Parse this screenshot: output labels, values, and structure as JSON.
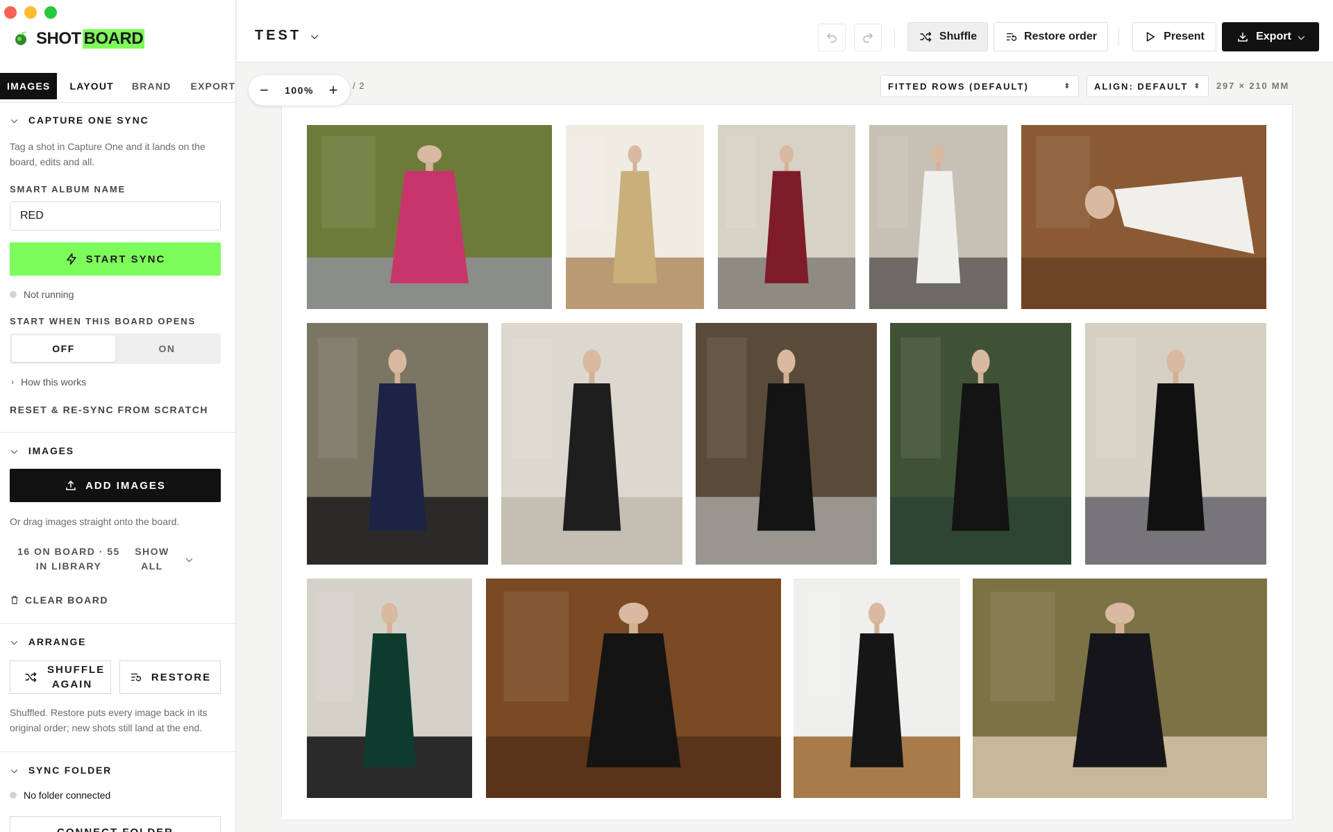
{
  "app": {
    "logo": {
      "part1": "SHOT",
      "part2": "BOARD"
    }
  },
  "sidebar": {
    "tabs": [
      "IMAGES",
      "LAYOUT",
      "BRAND",
      "EXPORT"
    ],
    "capture_one": {
      "title": "CAPTURE ONE SYNC",
      "description": "Tag a shot in Capture One and it lands on the board, edits and all.",
      "album_label": "SMART ALBUM NAME",
      "album_value": "RED",
      "start_button": "START SYNC",
      "status": "Not running",
      "auto_start_label": "START WHEN THIS BOARD OPENS",
      "toggle_off": "OFF",
      "toggle_on": "ON",
      "toggle_selected": "OFF",
      "how_link": "How this works",
      "reset_link": "RESET & RE-SYNC FROM SCRATCH"
    },
    "images": {
      "title": "IMAGES",
      "add_button": "ADD IMAGES",
      "hint": "Or drag images straight onto the board.",
      "count_text": "16 ON BOARD · 55 IN LIBRARY",
      "filter_value": "SHOW ALL",
      "clear_button": "CLEAR BOARD"
    },
    "arrange": {
      "title": "ARRANGE",
      "shuffle_button": "SHUFFLE AGAIN",
      "restore_button": "RESTORE",
      "note": "Shuffled. Restore puts every image back in its original order; new shots still land at the end."
    },
    "sync_folder": {
      "title": "SYNC FOLDER",
      "status": "No folder connected",
      "connect_button": "CONNECT FOLDER"
    }
  },
  "topbar": {
    "board_name": "TEST",
    "shuffle": "Shuffle",
    "restore_order": "Restore order",
    "present": "Present",
    "export": "Export"
  },
  "canvas": {
    "zoom": "100%",
    "page_indicator": "2",
    "layout_select": "FITTED ROWS (DEFAULT)",
    "align_select": "ALIGN: DEFAULT",
    "paper_size": "297 × 210 MM"
  },
  "colors": {
    "accent_green": "#7dfd5c",
    "dark": "#111111"
  },
  "photos": [
    {
      "name": "photo-pink-dress",
      "bg": "#6d7b3a",
      "garment": "#c8356a",
      "floor": "#8a8d88"
    },
    {
      "name": "photo-gold-gown",
      "bg": "#efece4",
      "garment": "#c9b07a",
      "floor": "#b99a74"
    },
    {
      "name": "photo-burgundy-dress",
      "bg": "#d8d2c6",
      "garment": "#7e1c2a",
      "floor": "#8f8a82"
    },
    {
      "name": "photo-white-knit-dress",
      "bg": "#c7c0b5",
      "garment": "#efefec",
      "floor": "#6e6a66"
    },
    {
      "name": "photo-white-fringe-floor",
      "bg": "#8a5a34",
      "garment": "#f1efe9",
      "floor": "#6d4425"
    },
    {
      "name": "photo-navy-dress-balcony",
      "bg": "#7b7663",
      "garment": "#1d2344",
      "floor": "#2c2a28"
    },
    {
      "name": "photo-polka-dot-dress",
      "bg": "#ddd8cf",
      "garment": "#1e1e1e",
      "floor": "#c4beb3"
    },
    {
      "name": "photo-black-lace-gown",
      "bg": "#5a4a3a",
      "garment": "#141414",
      "floor": "#9a968f"
    },
    {
      "name": "photo-black-bomber-bench",
      "bg": "#3f5236",
      "garment": "#141414",
      "floor": "#2f4534"
    },
    {
      "name": "photo-black-fringe-gown-street",
      "bg": "#d6d0c4",
      "garment": "#111111",
      "floor": "#77757a"
    },
    {
      "name": "photo-green-gown-balcony",
      "bg": "#d4d1c9",
      "garment": "#0f3b2f",
      "floor": "#2a2a2a"
    },
    {
      "name": "photo-black-dress-wood-door",
      "bg": "#7a4a24",
      "garment": "#141414",
      "floor": "#5a3418"
    },
    {
      "name": "photo-black-dress-seated",
      "bg": "#efefed",
      "garment": "#161616",
      "floor": "#a77b4a"
    },
    {
      "name": "photo-black-suit-terrace",
      "bg": "#7d7245",
      "garment": "#16161a",
      "floor": "#c8b89a"
    }
  ]
}
